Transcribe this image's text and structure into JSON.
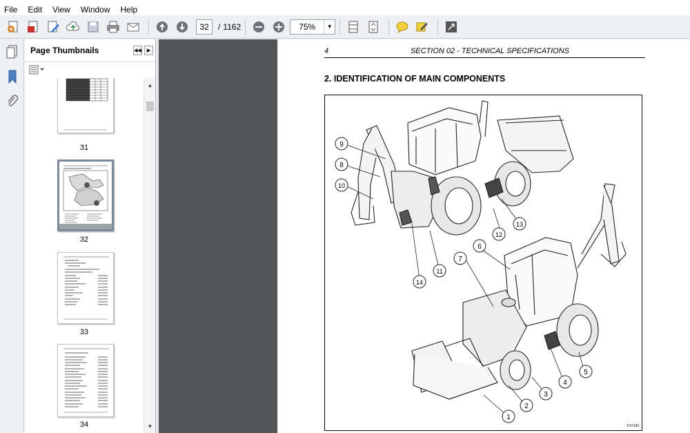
{
  "menu": [
    "File",
    "Edit",
    "View",
    "Window",
    "Help"
  ],
  "toolbar": {
    "current_page": "32",
    "separator": "/",
    "total_pages": "1162",
    "zoom": "75%"
  },
  "panel": {
    "title": "Page Thumbnails",
    "thumbnails": [
      {
        "label": "31"
      },
      {
        "label": "32"
      },
      {
        "label": "33"
      },
      {
        "label": "34"
      }
    ]
  },
  "document": {
    "page_number": "4",
    "section_title": "SECTION 02 - TECHNICAL SPECIFICATIONS",
    "heading": "2.    IDENTIFICATION OF MAIN COMPONENTS",
    "figure_id": "F37199",
    "callouts": [
      "9",
      "8",
      "10",
      "12",
      "13",
      "6",
      "7",
      "11",
      "14",
      "5",
      "4",
      "3",
      "2",
      "1"
    ]
  }
}
